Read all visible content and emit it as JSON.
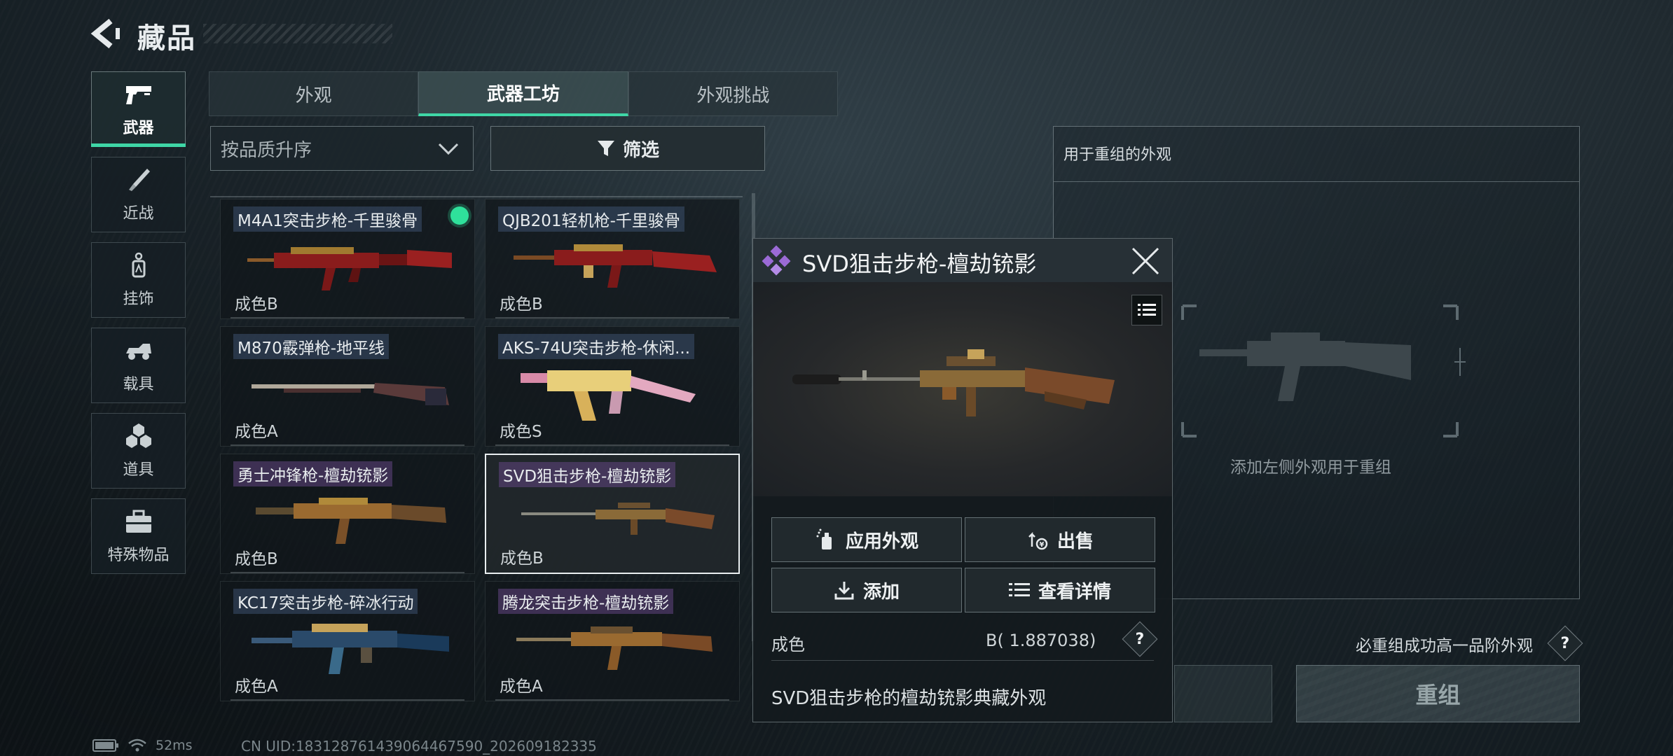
{
  "header": {
    "title": "藏品"
  },
  "sidebar": {
    "items": [
      {
        "label": "武器",
        "icon": "pistol-icon",
        "active": true
      },
      {
        "label": "近战",
        "icon": "knife-icon"
      },
      {
        "label": "挂饰",
        "icon": "charm-icon"
      },
      {
        "label": "载具",
        "icon": "vehicle-icon"
      },
      {
        "label": "道具",
        "icon": "grenades-icon"
      },
      {
        "label": "特殊物品",
        "icon": "toolbox-icon"
      }
    ]
  },
  "tabs": [
    {
      "label": "外观"
    },
    {
      "label": "武器工坊",
      "active": true
    },
    {
      "label": "外观挑战"
    }
  ],
  "sort": {
    "label": "按品质升序"
  },
  "filter": {
    "label": "筛选"
  },
  "weapons": [
    {
      "name": "M4A1突击步枪-千里骏骨",
      "grade": "成色B",
      "equipped": true
    },
    {
      "name": "QJB201轻机枪-千里骏骨",
      "grade": "成色B"
    },
    {
      "name": "M870霰弹枪-地平线",
      "grade": "成色A"
    },
    {
      "name": "AKS-74U突击步枪-休闲...",
      "grade": "成色S"
    },
    {
      "name": "勇士冲锋枪-檀劫铳影",
      "grade": "成色B"
    },
    {
      "name": "SVD狙击步枪-檀劫铳影",
      "grade": "成色B",
      "selected": true
    },
    {
      "name": "KC17突击步枪-碎冰行动",
      "grade": "成色A"
    },
    {
      "name": "腾龙突击步枪-檀劫铳影",
      "grade": "成色A"
    }
  ],
  "detail": {
    "title": "SVD狙击步枪-檀劫铳影",
    "apply_label": "应用外观",
    "sell_label": "出售",
    "add_label": "添加",
    "view_label": "查看详情",
    "grade_label": "成色",
    "grade_value": "B( 1.887038)",
    "description": "SVD狙击步枪的檀劫铳影典藏外观"
  },
  "recombine": {
    "title": "用于重组的外观",
    "hint": "添加左侧外观用于重组",
    "guaranteed": "必重组成功高一品阶外观",
    "button_label": "重组"
  },
  "status": {
    "ping": "52ms",
    "uid": "CN UID:18312876143906446759​0_202609182335"
  },
  "colors": {
    "accent": "#3fd6a6",
    "equipped_dot": "#2fe09b",
    "rarity_diamond": "#9b6ad6"
  }
}
